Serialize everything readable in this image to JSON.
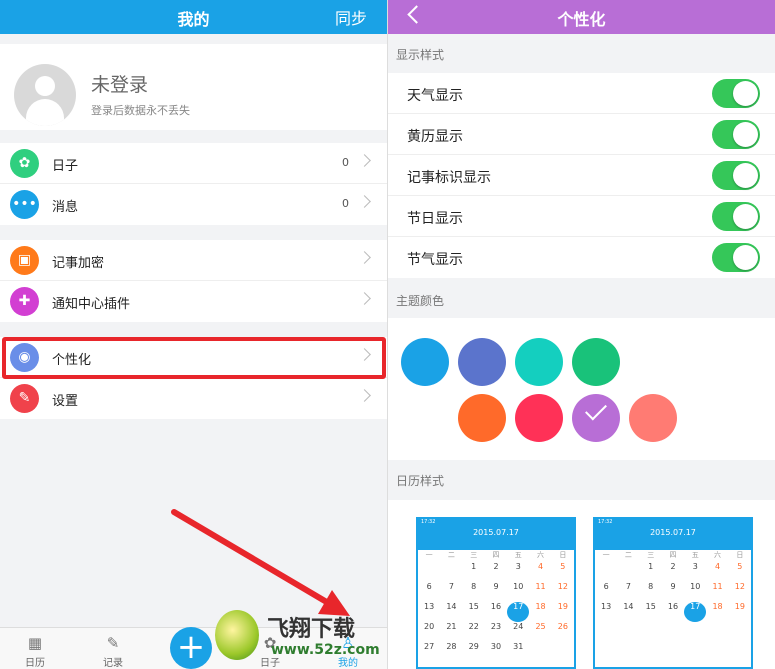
{
  "left": {
    "header_title": "我的",
    "header_action": "同步",
    "profile": {
      "name": "未登录",
      "subtitle": "登录后数据永不丢失"
    },
    "group1": [
      {
        "label": "日子",
        "count": "0",
        "icon": "pinwheel-icon",
        "color": "#2fcf7f"
      },
      {
        "label": "消息",
        "count": "0",
        "icon": "chat-bubble-icon",
        "color": "#1aa2e6"
      }
    ],
    "group2": [
      {
        "label": "记事加密",
        "icon": "lock-icon",
        "color": "#ff7a1a"
      },
      {
        "label": "通知中心插件",
        "icon": "puzzle-icon",
        "color": "#d23fd2"
      }
    ],
    "group3": [
      {
        "label": "个性化",
        "icon": "tshirt-icon",
        "color": "#6a8ee8"
      },
      {
        "label": "设置",
        "icon": "wrench-icon",
        "color": "#f0424b"
      }
    ],
    "tabbar": [
      {
        "label": "日历",
        "icon": "calendar-icon"
      },
      {
        "label": "记录",
        "icon": "edit-icon"
      },
      {
        "label": "日子",
        "icon": "pinwheel-icon"
      },
      {
        "label": "我的",
        "icon": "person-icon"
      }
    ],
    "accent": "#1aa2e6",
    "highlight_color": "#e8262b"
  },
  "right": {
    "header_title": "个性化",
    "section_display": "显示样式",
    "toggles": [
      {
        "label": "天气显示",
        "on": true
      },
      {
        "label": "黄历显示",
        "on": true
      },
      {
        "label": "记事标识显示",
        "on": true
      },
      {
        "label": "节日显示",
        "on": true
      },
      {
        "label": "节气显示",
        "on": true
      }
    ],
    "section_theme": "主题颜色",
    "theme_colors": [
      "#1aa2e6",
      "#5b74cc",
      "#14cfbf",
      "#19c27a",
      "#ff6a2a",
      "#ff3157",
      "#b86ed6",
      "#ff7b73"
    ],
    "theme_selected_index": 6,
    "section_calendar": "日历样式",
    "calendar_previews": [
      {
        "date": "2015.07.17",
        "time": "17:32",
        "weekdays": [
          "一",
          "二",
          "三",
          "四",
          "五",
          "六",
          "日"
        ],
        "rows": [
          [
            "",
            "",
            "1",
            "2",
            "3",
            "4",
            "5"
          ],
          [
            "6",
            "7",
            "8",
            "9",
            "10",
            "11",
            "12"
          ],
          [
            "13",
            "14",
            "15",
            "16",
            "17",
            "18",
            "19"
          ],
          [
            "20",
            "21",
            "22",
            "23",
            "24",
            "25",
            "26"
          ],
          [
            "27",
            "28",
            "29",
            "30",
            "31",
            "",
            ""
          ]
        ]
      },
      {
        "date": "2015.07.17",
        "time": "17:32",
        "weekdays": [
          "一",
          "二",
          "三",
          "四",
          "五",
          "六",
          "日"
        ],
        "rows": [
          [
            "",
            "",
            "1",
            "2",
            "3",
            "4",
            "5"
          ],
          [
            "6",
            "7",
            "8",
            "9",
            "10",
            "11",
            "12"
          ],
          [
            "13",
            "14",
            "15",
            "16",
            "17",
            "18",
            "19"
          ]
        ]
      }
    ],
    "accent": "#b86ed6"
  },
  "watermark": {
    "text": "飞翔下载",
    "url": "www.52z.com"
  }
}
